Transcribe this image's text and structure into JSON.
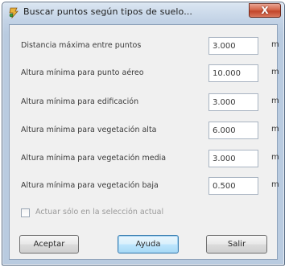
{
  "window": {
    "title": "Buscar puntos según tipos de suelo...",
    "close_label": "X"
  },
  "fields": [
    {
      "label": "Distancia máxima entre puntos",
      "value": "3.000",
      "unit": "m"
    },
    {
      "label": "Altura mínima para punto aéreo",
      "value": "10.000",
      "unit": "m"
    },
    {
      "label": "Altura mínima para edificación",
      "value": "3.000",
      "unit": "m"
    },
    {
      "label": "Altura mínima para vegetación alta",
      "value": "6.000",
      "unit": "m"
    },
    {
      "label": "Altura mínima para vegetación media",
      "value": "3.000",
      "unit": "m"
    },
    {
      "label": "Altura mínima para vegetación baja",
      "value": "0.500",
      "unit": "m"
    }
  ],
  "option": {
    "label": "Actuar sólo en la selección actual",
    "checked": false
  },
  "buttons": {
    "accept": "Aceptar",
    "help": "Ayuda",
    "exit": "Salir"
  },
  "colors": {
    "title_bar": "#c3d3e6",
    "close_button": "#c2452a",
    "client_bg": "#f0f0f0",
    "focused_button": "#bee6fd"
  }
}
